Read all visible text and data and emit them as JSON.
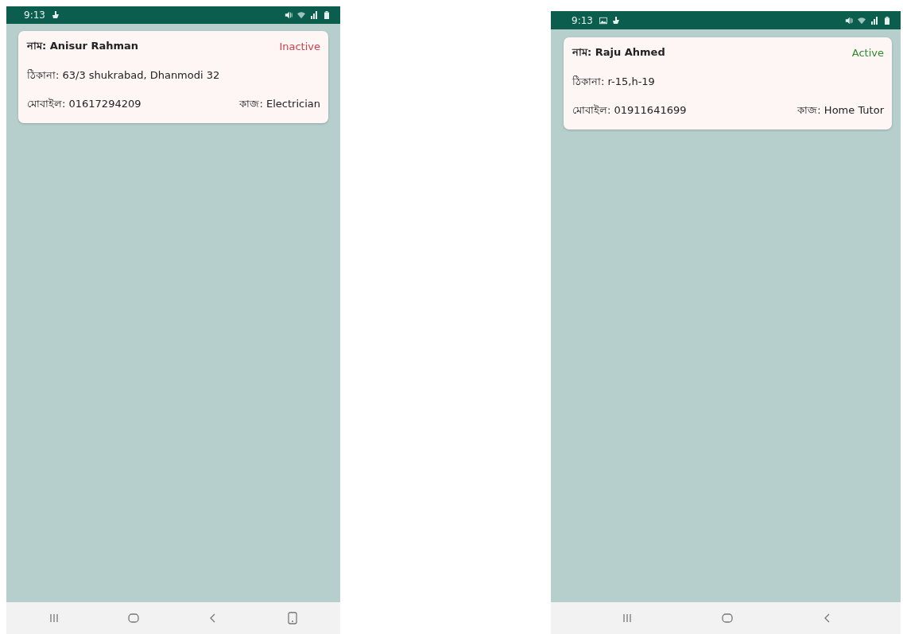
{
  "screens": [
    {
      "status_bar": {
        "time": "9:13",
        "notification_icons": [
          {
            "kind": "boat"
          }
        ]
      },
      "card": {
        "name": "নাম: Anisur Rahman",
        "status": "Inactive",
        "active": false,
        "address": "ঠিকানা: 63/3 shukrabad, Dhanmodi 32",
        "mobile": "মোবাইল: 01617294209",
        "job": "কাজ: Electrician"
      },
      "nav_buttons": [
        {
          "kind": "recents"
        },
        {
          "kind": "home"
        },
        {
          "kind": "back"
        },
        {
          "kind": "keyboard"
        }
      ]
    },
    {
      "status_bar": {
        "time": "9:13",
        "notification_icons": [
          {
            "kind": "image"
          },
          {
            "kind": "boat"
          }
        ]
      },
      "card": {
        "name": "নাম: Raju Ahmed",
        "status": "Active",
        "active": true,
        "address": "ঠিকানা: r-15,h-19",
        "mobile": "মোবাইল: 01911641699",
        "job": "কাজ: Home Tutor"
      },
      "nav_buttons": [
        {
          "kind": "recents"
        },
        {
          "kind": "home"
        },
        {
          "kind": "back"
        }
      ]
    }
  ]
}
